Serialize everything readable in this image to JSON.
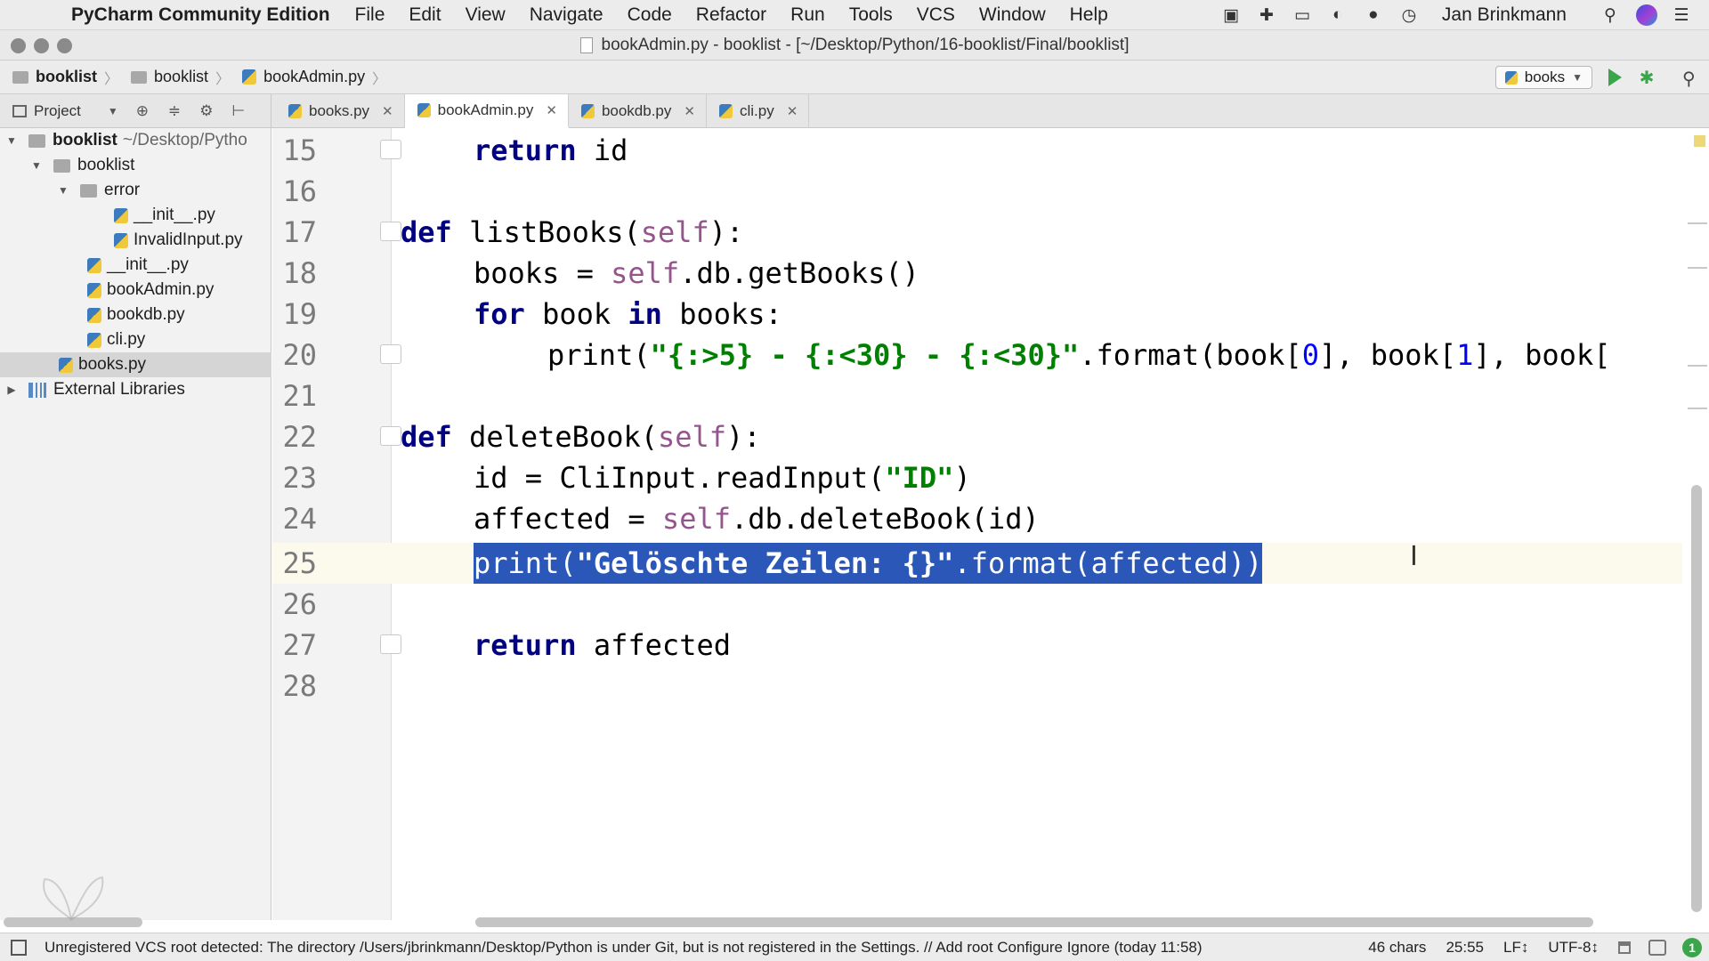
{
  "menubar": {
    "app_name": "PyCharm Community Edition",
    "items": [
      "File",
      "Edit",
      "View",
      "Navigate",
      "Code",
      "Refactor",
      "Run",
      "Tools",
      "VCS",
      "Window",
      "Help"
    ],
    "user": "Jan Brinkmann"
  },
  "window": {
    "title": "bookAdmin.py - booklist - [~/Desktop/Python/16-booklist/Final/booklist]"
  },
  "navbar": {
    "breadcrumbs": [
      "booklist",
      "booklist",
      "bookAdmin.py"
    ],
    "run_config": "books"
  },
  "tool_window": {
    "label": "Project"
  },
  "tabs": [
    {
      "label": "books.py",
      "active": false
    },
    {
      "label": "bookAdmin.py",
      "active": true
    },
    {
      "label": "bookdb.py",
      "active": false
    },
    {
      "label": "cli.py",
      "active": false
    }
  ],
  "tree": [
    {
      "label": "booklist",
      "extra": "~/Desktop/Pytho",
      "type": "folder",
      "depth": 0,
      "expanded": true
    },
    {
      "label": "booklist",
      "type": "folder",
      "depth": 1,
      "expanded": true
    },
    {
      "label": "error",
      "type": "folder",
      "depth": 2,
      "expanded": true
    },
    {
      "label": "__init__.py",
      "type": "file",
      "depth": 3
    },
    {
      "label": "InvalidInput.py",
      "type": "file",
      "depth": 3
    },
    {
      "label": "__init__.py",
      "type": "file",
      "depth": 2
    },
    {
      "label": "bookAdmin.py",
      "type": "file",
      "depth": 2
    },
    {
      "label": "bookdb.py",
      "type": "file",
      "depth": 2
    },
    {
      "label": "cli.py",
      "type": "file",
      "depth": 2
    },
    {
      "label": "books.py",
      "type": "file",
      "depth": 1,
      "selected": true
    },
    {
      "label": "External Libraries",
      "type": "lib",
      "depth": 0,
      "expanded": false
    }
  ],
  "code": {
    "line_numbers": [
      "15",
      "16",
      "17",
      "18",
      "19",
      "20",
      "21",
      "22",
      "23",
      "24",
      "25",
      "26",
      "27",
      "28"
    ],
    "l15": {
      "kw": "return",
      "rest": " id"
    },
    "l17": {
      "kw": "def",
      "name": " listBooks(",
      "self": "self",
      "end": "):"
    },
    "l18": {
      "a": "books = ",
      "self": "self",
      "b": ".db.getBooks()"
    },
    "l19": {
      "kw1": "for",
      "a": " book ",
      "kw2": "in",
      "b": " books:"
    },
    "l20": {
      "a": "print(",
      "str": "\"{:>5} - {:<30} - {:<30}\"",
      "b": ".format(book[",
      "n0": "0",
      "c": "], book[",
      "n1": "1",
      "d": "], book["
    },
    "l22": {
      "kw": "def",
      "name": " deleteBook(",
      "self": "self",
      "end": "):"
    },
    "l23": {
      "a": "id = CliInput.readInput(",
      "str": "\"ID\"",
      "b": ")"
    },
    "l24": {
      "a": "affected = ",
      "self": "self",
      "b": ".db.deleteBook(id)"
    },
    "l25": {
      "a": "print(",
      "str": "\"Gelöschte Zeilen: {}\"",
      "b": ".format(affected))"
    },
    "l27": {
      "kw": "return",
      "rest": " affected"
    }
  },
  "status": {
    "message": "Unregistered VCS root detected: The directory /Users/jbrinkmann/Desktop/Python is under Git, but is not registered in the Settings. // Add root  Configure  Ignore (today 11:58)",
    "chars": "46 chars",
    "position": "25:55",
    "line_sep": "LF↕",
    "encoding": "UTF-8↕",
    "notifications": "1"
  },
  "colors": {
    "selection": "#2b58b8",
    "keyword": "#000080",
    "string": "#008000",
    "self": "#94558d",
    "number": "#0000ff",
    "run_green": "#3aa54a"
  }
}
